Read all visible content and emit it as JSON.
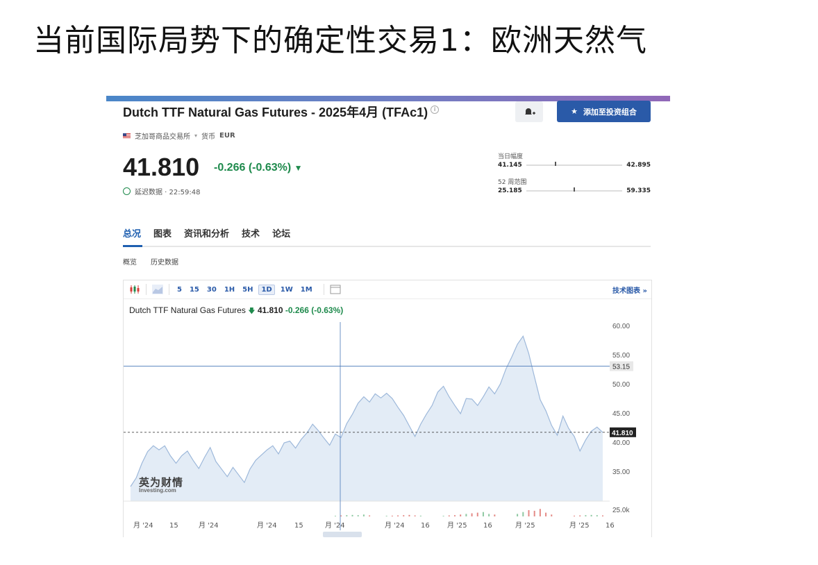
{
  "slide": {
    "title": "当前国际局势下的确定性交易1：欧洲天然气"
  },
  "header": {
    "instrument_title": "Dutch TTF Natural Gas Futures - 2025年4月 (TFAc1)",
    "add_portfolio_label": "添加至投资组合",
    "exchange": "芝加哥商品交易所",
    "currency_label": "货币",
    "currency": "EUR"
  },
  "quote": {
    "price": "41.810",
    "change": "-0.266",
    "change_pct": "(-0.63%)",
    "delay_label": "延迟数据 · 22:59:48"
  },
  "day_range": {
    "label": "当日幅度",
    "low": "41.145",
    "high": "42.895",
    "marker_pos": 0.3
  },
  "week52_range": {
    "label": "52 周范围",
    "low": "25.185",
    "high": "59.335",
    "marker_pos": 0.49
  },
  "tabs": [
    "总况",
    "图表",
    "资讯和分析",
    "技术",
    "论坛"
  ],
  "subtabs": [
    "概览",
    "历史数据"
  ],
  "toolbar": {
    "intervals": [
      "5",
      "15",
      "30",
      "1H",
      "5H",
      "1D",
      "1W",
      "1M"
    ],
    "selected_interval": "1D",
    "tech_chart_label": "技术图表 »"
  },
  "legend": {
    "name": "Dutch TTF Natural Gas Futures",
    "value": "41.810",
    "change": "-0.266 (-0.63%)"
  },
  "watermark": {
    "cn": "英为财情",
    "en": "Investing.com"
  },
  "colors": {
    "accent": "#2a5aa8",
    "up": "#1e8a4c",
    "down": "#d43f3a",
    "area_fill": "#e3ecf6",
    "line": "#9db8da"
  },
  "chart_data": {
    "type": "area",
    "ylim": [
      30,
      60
    ],
    "y_ticks": [
      "60.00",
      "55.00",
      "50.00",
      "45.00",
      "40.00",
      "35.00"
    ],
    "volume_tick": "25.0k",
    "crosshair_y_label": "53.15",
    "last_price_label": "41.810",
    "x_ticks": [
      "月 '24",
      "15",
      "月 '24",
      "月 '24",
      "15",
      "月 '24",
      "月 '24",
      "16",
      "月 '25",
      "16",
      "月 '25",
      "月 '25",
      "16"
    ],
    "values": [
      32.5,
      34,
      36.5,
      38.5,
      39.5,
      38.8,
      39.5,
      37.8,
      36.5,
      37.8,
      38.6,
      37,
      35.6,
      37.5,
      39.2,
      36.8,
      35.5,
      34.2,
      35.8,
      34.5,
      33.2,
      35.5,
      37,
      37.9,
      38.8,
      39.5,
      38.1,
      40,
      40.3,
      39.1,
      40.6,
      41.7,
      43.2,
      42.1,
      40.8,
      39.6,
      41.5,
      40.9,
      43.3,
      44.9,
      46.8,
      47.9,
      47,
      48.4,
      47.7,
      48.5,
      47.6,
      46.1,
      44.7,
      42.9,
      41.1,
      43.2,
      44.9,
      46.4,
      48.7,
      49.7,
      47.9,
      46.4,
      45,
      47.6,
      47.5,
      46.4,
      47.9,
      49.6,
      48.4,
      50.1,
      52.7,
      54.7,
      56.9,
      58.3,
      55.3,
      51.3,
      47.4,
      45.5,
      43,
      41.3,
      44.6,
      42.5,
      41.1,
      38.6,
      40.5,
      42,
      42.7,
      41.8
    ],
    "volume": [
      0,
      0,
      0,
      0,
      0,
      0,
      0,
      0,
      0,
      0,
      0,
      0,
      0,
      0,
      0,
      0,
      0,
      0,
      0,
      0,
      0,
      0,
      0,
      0,
      0,
      0,
      0,
      0,
      0,
      0,
      0,
      0,
      0,
      0,
      0,
      0,
      0.05,
      0.08,
      0.1,
      0.12,
      0.1,
      0.15,
      0.08,
      0,
      0,
      0.05,
      0.06,
      0.08,
      0.1,
      0.12,
      0.08,
      0.06,
      0,
      0,
      0,
      0.05,
      0.08,
      0.1,
      0.15,
      0.2,
      0.25,
      0.3,
      0.35,
      0.2,
      0.15,
      0,
      0,
      0,
      0.2,
      0.35,
      0.5,
      0.45,
      0.6,
      0.3,
      0.15,
      0,
      0,
      0,
      0.06,
      0.08,
      0.1,
      0.12,
      0.1,
      0.08
    ]
  }
}
